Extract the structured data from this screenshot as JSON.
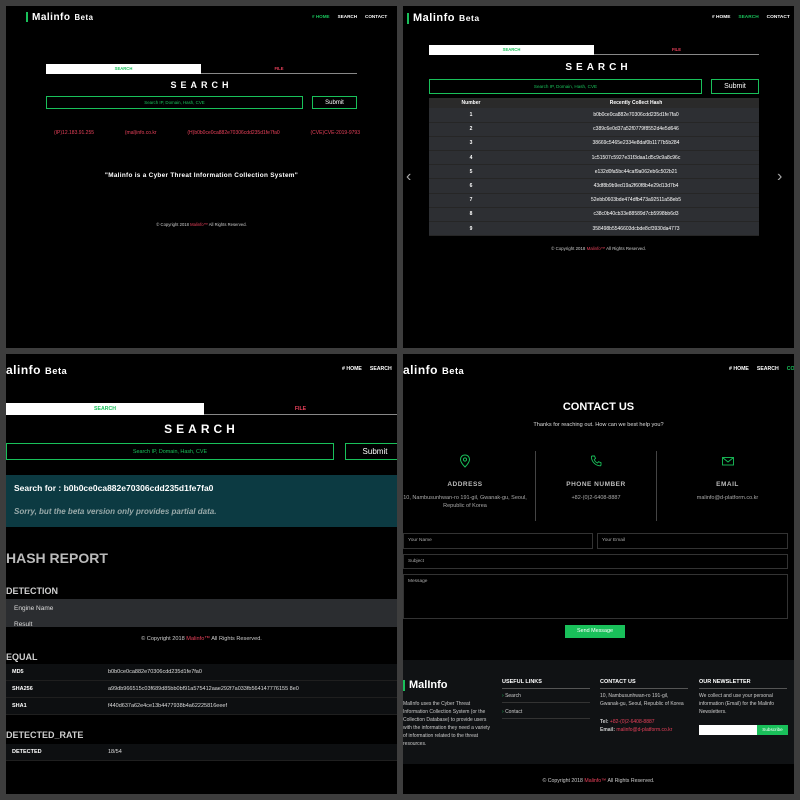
{
  "brand": {
    "name": "Malinfo",
    "beta": "Beta",
    "name_cut": "alinfo",
    "footer_name": "MalInfo"
  },
  "nav": {
    "home": "# HOME",
    "search": "SEARCH",
    "contact": "CONTACT",
    "contact_cut": "CO"
  },
  "tabs": {
    "search": "SEARCH",
    "file": "FILE"
  },
  "search": {
    "title": "SEARCH",
    "placeholder": "Search IP, Domain, Hash, CVE",
    "submit": "Submit"
  },
  "samples": [
    "(IP)12.183.91.255",
    "(mal)info.co.kr",
    "(H)b0b0ce0ca882e70306cdd235d1fe7fa0",
    "(CVE)CVE-2019-9793"
  ],
  "tagline": "\"Malinfo is a Cyber Threat Information Collection System\"",
  "copyright": {
    "prefix": "© Copyright 2018",
    "brand": "Malinfo™",
    "suffix": "All Rights Reserved."
  },
  "hash_table": {
    "headers": [
      "Number",
      "Recently Collect Hash"
    ],
    "rows": [
      [
        "1",
        "b0b0ce0ca882e70306cdd235d1fe7fa0"
      ],
      [
        "2",
        "c389c6e0d37a52f0779f8552d4e5d646"
      ],
      [
        "3",
        "38669c5465e2334e8daf0b1177b5b284"
      ],
      [
        "4",
        "1c51507c5927e31f3daa1d5c9c9a8c96c"
      ],
      [
        "5",
        "e132d0fa5bc44caf9a062eb6c502b21"
      ],
      [
        "6",
        "43df8b9b9ed19a2f60f8b4e29d13d7b4"
      ],
      [
        "7",
        "52ebb0603bde474dfb473a92511a58eb5"
      ],
      [
        "8",
        "c38c0b40cb33e88589d7cb5998bb6d3"
      ],
      [
        "9",
        "358498b5546603dcbde8cf3930da4773"
      ]
    ]
  },
  "result": {
    "heading": "Search for : b0b0ce0ca882e70306cdd235d1fe7fa0",
    "notice": "Sorry, but the beta version only provides partial data.",
    "report_title": "HASH REPORT",
    "detection": "DETECTION",
    "engine_name": "Engine Name",
    "result_cut": "Result",
    "equal": "EQUAL",
    "equal_rows": [
      {
        "key": "MD5",
        "value": "b0b0ce0ca882e70306cdd235d1fe7fa0"
      },
      {
        "key": "SHA256",
        "value": "a99db966515c03f689d85bb0bf91a575412aae292f7a033fb564147776155 8e0"
      },
      {
        "key": "SHA1",
        "value": "f440d637a62e4ce13b4477938b4a62225816eeef"
      }
    ],
    "detected_rate": "DETECTED_RATE",
    "detected_label": "DETECTED",
    "detected_value": "18/54"
  },
  "contact": {
    "title": "CONTACT US",
    "subtitle": "Thanks for reaching out. How can we best help you?",
    "address_label": "ADDRESS",
    "address_value": "10, Nambusunhwan-ro 191-gil, Gwanak-gu, Seoul, Republic of Korea",
    "phone_label": "PHONE NUMBER",
    "phone_value": "+82-(0)2-6408-8887",
    "email_label": "EMAIL",
    "email_value": "malinfo@d-platform.co.kr",
    "name_ph": "Your Name",
    "email_ph": "Your Email",
    "subject_ph": "Subject",
    "message_ph": "Message",
    "send": "Send Message"
  },
  "footer": {
    "about": "MalInfo uses the Cyber Threat Information Collection System (or the Collection Database) to provide users with the information they need a variety of information related to the threat resources.",
    "useful_links": "USEFUL LINKS",
    "link_search": "Search",
    "link_contact": "Contact",
    "contact_us": "CONTACT US",
    "addr": "10, Nambusunhwan-ro 191-gil, Gwanak-gu, Seoul, Republic of Korea",
    "tel_label": "Tel:",
    "tel": "+82-(0)2-6408-8887",
    "email_label": "Email:",
    "email": "malinfo@d-platform.co.kr",
    "newsletter": "OUR NEWSLETTER",
    "newsletter_text": "We collect and use your personal information (Email) for the Malinfo Newsletters.",
    "subscribe": "Subscribe"
  },
  "colors": {
    "accent_green": "#19c05a",
    "accent_red": "#e8405a",
    "result_bg": "#0c3a42"
  }
}
